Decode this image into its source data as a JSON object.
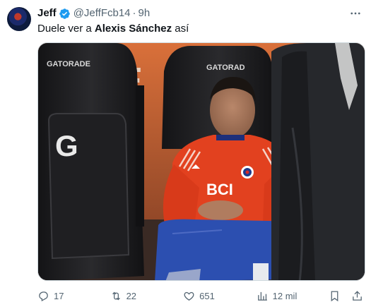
{
  "author": {
    "display_name": "Jeff",
    "handle": "@JeffFcb14",
    "separator": "·",
    "time": "9h"
  },
  "tweet": {
    "text_before": "Duele ver a ",
    "text_bold": "Alexis Sánchez",
    "text_after": " así"
  },
  "media": {
    "seat_brand_left": "GATORADE",
    "seat_brand_right": "GATORAD",
    "seat_logo": "G",
    "sign_letter": "E",
    "shirt_sponsor": "BCI",
    "accent_colors": {
      "shirt": "#e2411f",
      "shorts": "#2c4fb0",
      "seat": "#1d1d1f",
      "wall": "#d2652c"
    }
  },
  "actions": {
    "reply_count": "17",
    "retweet_count": "22",
    "like_count": "651",
    "views_count": "12 mil"
  },
  "colors": {
    "verified": "#1d9bf0",
    "muted": "#536471"
  }
}
